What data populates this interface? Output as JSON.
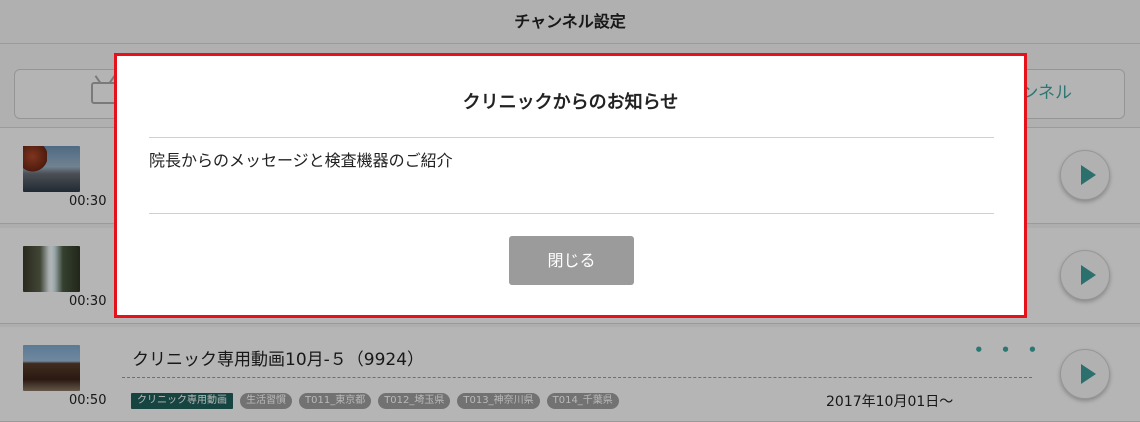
{
  "header": {
    "title": "チャンネル設定"
  },
  "tabs": {
    "right_label": "ンネル"
  },
  "rows": [
    {
      "duration": "00:30"
    },
    {
      "duration": "00:30"
    },
    {
      "duration": "00:50",
      "title": "クリニック専用動画10月-５（9924）",
      "more": "• • •",
      "tags": [
        "クリニック専用動画",
        "生活習慣",
        "T011_東京都",
        "T012_埼玉県",
        "T013_神奈川県",
        "T014_千葉県"
      ],
      "date": "2017年10月01日〜"
    }
  ],
  "modal": {
    "title": "クリニックからのお知らせ",
    "message": "院長からのメッセージと検査機器のご紹介",
    "close_label": "閉じる",
    "highlight_color": "#e5121b"
  },
  "colors": {
    "accent": "#3fa5a0",
    "tag_primary": "#1f5f5a",
    "tag": "#9f9f9f"
  }
}
